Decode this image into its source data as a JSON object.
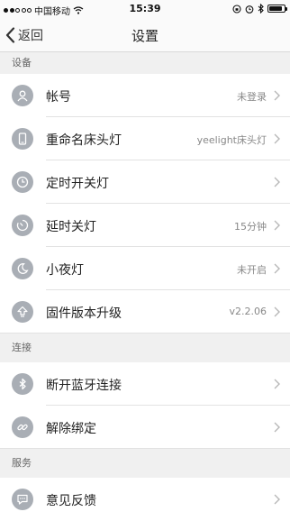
{
  "status_bar": {
    "carrier": "中国移动",
    "time": "15:39",
    "battery_level": 0.9
  },
  "nav": {
    "back_label": "返回",
    "title": "设置"
  },
  "sections": {
    "device": {
      "header": "设备",
      "items": [
        {
          "label": "帐号",
          "value": "未登录",
          "icon": "user-icon"
        },
        {
          "label": "重命名床头灯",
          "value": "yeelight床头灯",
          "icon": "phone-icon"
        },
        {
          "label": "定时开关灯",
          "value": "",
          "icon": "clock-icon"
        },
        {
          "label": "延时关灯",
          "value": "15分钟",
          "icon": "timer-icon"
        },
        {
          "label": "小夜灯",
          "value": "未开启",
          "icon": "moon-icon"
        },
        {
          "label": "固件版本升级",
          "value": "v2.2.06",
          "icon": "upgrade-arrow-icon"
        }
      ]
    },
    "connection": {
      "header": "连接",
      "items": [
        {
          "label": "断开蓝牙连接",
          "value": "",
          "icon": "bluetooth-icon"
        },
        {
          "label": "解除绑定",
          "value": "",
          "icon": "link-icon"
        }
      ]
    },
    "service": {
      "header": "服务",
      "items": [
        {
          "label": "意见反馈",
          "value": "",
          "icon": "feedback-icon"
        }
      ]
    }
  }
}
